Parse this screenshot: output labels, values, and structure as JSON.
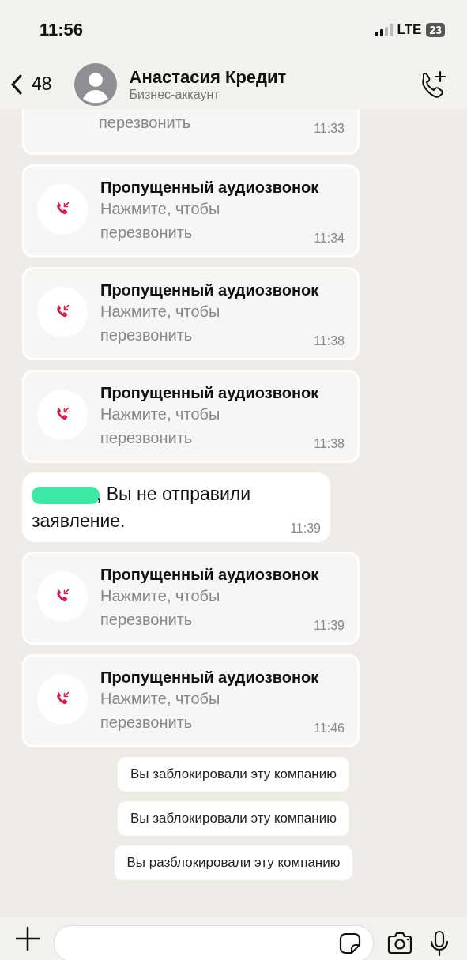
{
  "status_bar": {
    "time": "11:56",
    "network": "LTE",
    "battery": "23"
  },
  "header": {
    "back_count": "48",
    "name": "Анастасия Кредит",
    "subtitle": "Бизнес-аккаунт"
  },
  "messages": [
    {
      "kind": "missed_call_partial",
      "subtitle": "перезвонить",
      "time": "11:33"
    },
    {
      "kind": "missed_call",
      "title": "Пропущенный аудиозвонок",
      "subtitle": "Нажмите, чтобы перезвонить",
      "time": "11:34"
    },
    {
      "kind": "missed_call",
      "title": "Пропущенный аудиозвонок",
      "subtitle": "Нажмите, чтобы перезвонить",
      "time": "11:38"
    },
    {
      "kind": "missed_call",
      "title": "Пропущенный аудиозвонок",
      "subtitle": "Нажмите, чтобы перезвонить",
      "time": "11:38"
    },
    {
      "kind": "text",
      "redacted": true,
      "text": ", Вы не отправили заявление.",
      "time": "11:39"
    },
    {
      "kind": "missed_call",
      "title": "Пропущенный аудиозвонок",
      "subtitle": "Нажмите, чтобы перезвонить",
      "time": "11:39"
    },
    {
      "kind": "missed_call",
      "title": "Пропущенный аудиозвонок",
      "subtitle": "Нажмите, чтобы перезвонить",
      "time": "11:46"
    },
    {
      "kind": "system",
      "text": "Вы заблокировали эту компанию"
    },
    {
      "kind": "system",
      "text": "Вы заблокировали эту компанию"
    },
    {
      "kind": "system",
      "text": "Вы разблокировали эту компанию"
    }
  ]
}
